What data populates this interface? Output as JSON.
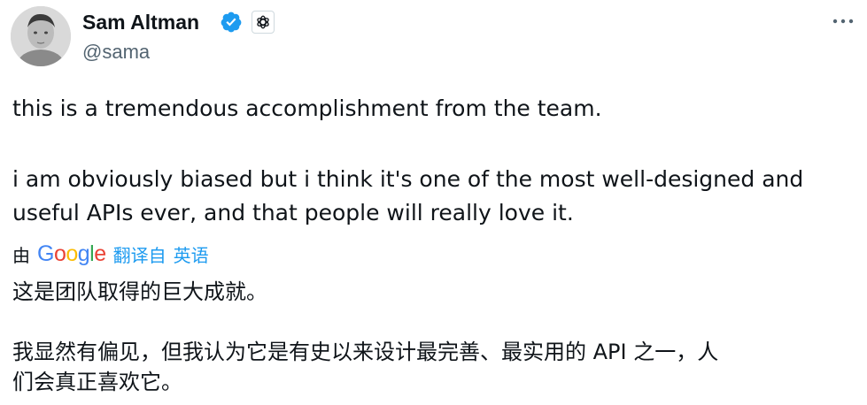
{
  "author": {
    "name": "Sam Altman",
    "handle": "@sama",
    "verified_icon": "verified-badge-icon",
    "affiliate_icon": "openai-logo-icon"
  },
  "menu": {
    "icon": "more-horizontal-icon"
  },
  "tweet": {
    "paragraph_1": "this is a tremendous accomplishment from the team.",
    "paragraph_2_line_1": "i am obviously biased but i think it's one of the most well-designed and",
    "paragraph_2_line_2": "useful APIs ever, and that people will really love it."
  },
  "translation": {
    "by_label": "由",
    "provider": "Google",
    "provider_letters": [
      "G",
      "o",
      "o",
      "g",
      "l",
      "e"
    ],
    "from_label": "翻译自",
    "source_language": "英语",
    "paragraph_1": "这是团队取得的巨大成就。",
    "paragraph_2_line_1": "我显然有偏见，但我认为它是有史以来设计最完善、最实用的 API 之一，人",
    "paragraph_2_line_2": "们会真正喜欢它。"
  },
  "colors": {
    "text_primary": "#0f1419",
    "text_secondary": "#536471",
    "link_blue": "#1d9bf0",
    "verified_blue": "#1d9bf0",
    "google_blue": "#4285f4",
    "google_red": "#ea4335",
    "google_yellow": "#fbbc05",
    "google_green": "#34a853"
  }
}
